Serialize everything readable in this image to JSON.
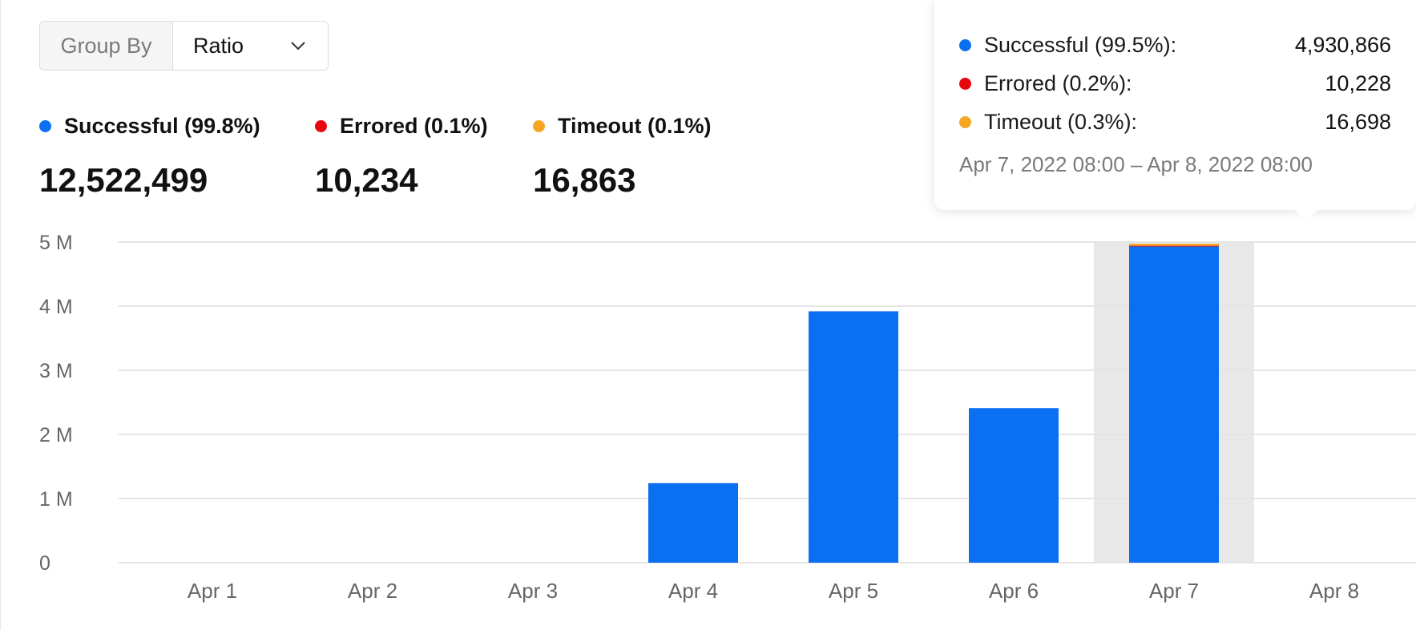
{
  "controls": {
    "group_by_label": "Group By",
    "group_by_value": "Ratio"
  },
  "summary": [
    {
      "label": "Successful (99.8%)",
      "value": "12,522,499",
      "color": "#0a6ff0"
    },
    {
      "label": "Errored (0.1%)",
      "value": "10,234",
      "color": "#e8060f"
    },
    {
      "label": "Timeout (0.1%)",
      "value": "16,863",
      "color": "#f5a623"
    }
  ],
  "tooltip": {
    "rows": [
      {
        "label": "Successful (99.5%):",
        "value": "4,930,866",
        "color": "#0a6ff0"
      },
      {
        "label": "Errored (0.2%):",
        "value": "10,228",
        "color": "#e8060f"
      },
      {
        "label": "Timeout (0.3%):",
        "value": "16,698",
        "color": "#f5a623"
      }
    ],
    "range": "Apr 7, 2022 08:00 – Apr 8, 2022 08:00"
  },
  "colors": {
    "successful": "#0a6ff0",
    "errored": "#e8060f",
    "timeout": "#f5a623",
    "highlight": "#e8e8e8",
    "grid": "#e4e4e4"
  },
  "chart_data": {
    "type": "bar",
    "stacked": true,
    "categories": [
      "Apr 1",
      "Apr 2",
      "Apr 3",
      "Apr 4",
      "Apr 5",
      "Apr 6",
      "Apr 7",
      "Apr 8"
    ],
    "series": [
      {
        "name": "Successful",
        "values": [
          0,
          0,
          0,
          1240000,
          3920000,
          2410000,
          4930866,
          0
        ]
      },
      {
        "name": "Errored",
        "values": [
          0,
          0,
          0,
          0,
          0,
          0,
          10228,
          0
        ]
      },
      {
        "name": "Timeout",
        "values": [
          0,
          0,
          0,
          0,
          0,
          0,
          16698,
          0
        ]
      }
    ],
    "ylim": [
      0,
      5000000
    ],
    "yticks": [
      0,
      1000000,
      2000000,
      3000000,
      4000000,
      5000000
    ],
    "ytick_labels": [
      "0",
      "1 M",
      "2 M",
      "3 M",
      "4 M",
      "5 M"
    ],
    "highlighted_category": "Apr 7",
    "grid": true
  }
}
